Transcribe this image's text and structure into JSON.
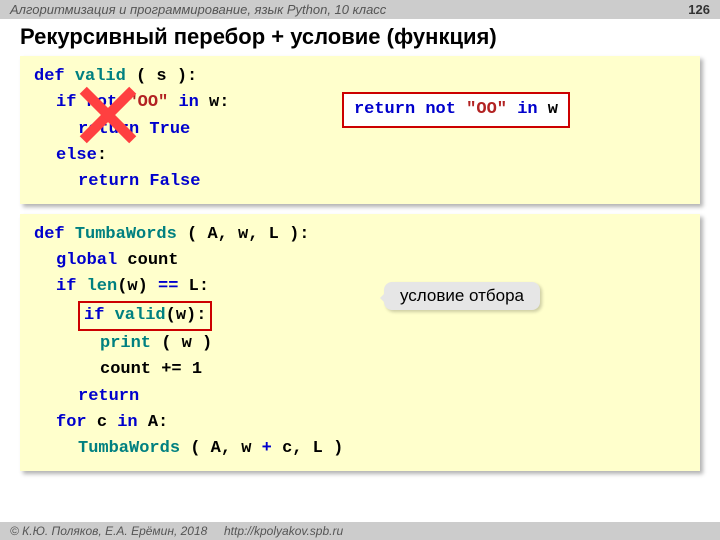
{
  "header": {
    "course": "Алгоритмизация и программирование, язык Python, 10 класс",
    "page": "126"
  },
  "title": "Рекурсивный перебор + условие (функция)",
  "block1": {
    "l1": {
      "def": "def",
      "fn": "valid",
      "rest": "( s ):"
    },
    "l2": {
      "a": "if not",
      "b": "\"ОО\"",
      "c": "in",
      "d": "w:"
    },
    "l3": {
      "a": "return",
      "b": "True"
    },
    "l4": {
      "a": "else",
      "b": ":"
    },
    "l5": {
      "a": "return",
      "b": "False"
    },
    "hint": {
      "a": "return not",
      "b": "\"ОО\"",
      "c": "in",
      "d": "w"
    }
  },
  "block2": {
    "l1": {
      "def": "def",
      "fn": "TumbaWords",
      "rest": "( A, w, L ):"
    },
    "l2": {
      "a": "global",
      "b": "count"
    },
    "l3": {
      "a": "if",
      "b": "len",
      "c": "(w)",
      "d": "==",
      "e": "L:"
    },
    "l4": {
      "a": "if",
      "b": "valid",
      "c": "(w):"
    },
    "l5": {
      "a": "print",
      "b": "( w )"
    },
    "l6": "count += 1",
    "l7": "return",
    "l8": {
      "a": "for",
      "b": "c",
      "c": "in",
      "d": "A:"
    },
    "l9": {
      "a": "TumbaWords",
      "b": "( A, w",
      "c": "+",
      "d": "c, L )"
    }
  },
  "callout": "условие отбора",
  "footer": {
    "copyright": "© К.Ю. Поляков, Е.А. Ерёмин, 2018",
    "url": "http://kpolyakov.spb.ru"
  }
}
